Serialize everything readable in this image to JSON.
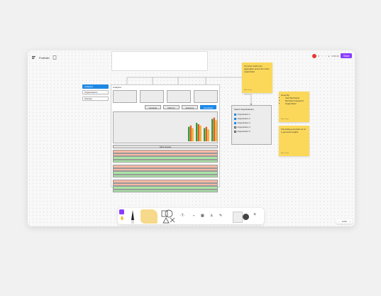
{
  "app": {
    "title": "Portfolio",
    "share_label": "Share",
    "timer_text": "0:00:19"
  },
  "colors": {
    "accent": "#8a3dff",
    "primary_button": "#1e88e5",
    "sticky_note": "#fbd85a",
    "row_red": "#f6b9a6",
    "row_green": "#a9e6a5"
  },
  "sidebar": {
    "items": [
      {
        "label": "Analytics",
        "active": true
      },
      {
        "label": "Organizations",
        "active": false
      },
      {
        "label": "Settings",
        "active": false
      }
    ]
  },
  "analytics": {
    "title": "Analytics",
    "buttons": [
      "Compare",
      "Filter by",
      "Group by",
      "Download"
    ],
    "table_header": "Table Header"
  },
  "chart_data": {
    "type": "bar",
    "series": [
      {
        "values": [
          0.55,
          0.7,
          0.5,
          0.85
        ]
      },
      {
        "values": [
          0.6,
          0.65,
          0.55,
          0.9
        ]
      },
      {
        "values": [
          0.5,
          0.6,
          0.45,
          0.8
        ]
      }
    ],
    "colors": [
      "#2e9e3e",
      "#e85d1e",
      "#f2a71b"
    ]
  },
  "table": {
    "rows": [
      "red",
      "red",
      "green",
      "green",
      "red",
      "red",
      "green",
      "green",
      "red",
      "red",
      "green",
      "green"
    ]
  },
  "org_panel": {
    "title": "Select Organizations",
    "items": [
      {
        "label": "Organization 1",
        "checked": true
      },
      {
        "label": "Organization 2",
        "checked": true
      },
      {
        "label": "Organization 3",
        "checked": true
      },
      {
        "label": "Organization 4",
        "checked": false
      },
      {
        "label": "Organization 5",
        "checked": false
      }
    ]
  },
  "stickies": [
    {
      "text": "Top level metrics are aggregates across the entire organization",
      "author": "Adam Sugar"
    },
    {
      "title": "Group By",
      "items": [
        "Card Merchants",
        "Merchant Categories",
        "Organization"
      ],
      "author": "Adam Sugar"
    },
    {
      "text": "Potentially good place for AI to generate insights",
      "author": "Adam Sugar"
    }
  ],
  "zoom": {
    "level": "100%"
  }
}
